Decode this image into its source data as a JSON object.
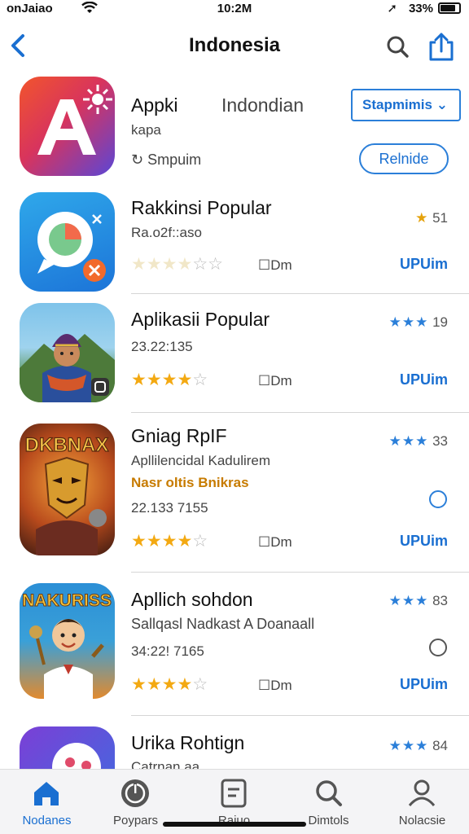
{
  "status": {
    "carrier": "onJaiao",
    "time": "10:2M",
    "battery": "33%"
  },
  "nav": {
    "title": "Indonesia"
  },
  "apps": [
    {
      "name": "Appki",
      "name_extra": "Indondian",
      "sub": "kapa",
      "extra": "Smpuim",
      "dropdown": "Stapmimis",
      "button": "Relnide"
    },
    {
      "name": "Rakkinsi Popular",
      "sub": "Ra.o2f::aso",
      "mid": "Dm",
      "rating": "51",
      "get": "UPUim"
    },
    {
      "name": "Aplikasii Popular",
      "sub": "23.22:135",
      "mid": "Dm",
      "rating": "19",
      "get": "UPUim"
    },
    {
      "name": "Gniag RpIF",
      "sub": "Apllilencidal Kadulirem",
      "sub2": "Nasr oltis Bnikras",
      "sub3": "22.133 7155",
      "mid": "Dm",
      "rating": "33",
      "get": "UPUim"
    },
    {
      "name": "Apllich sohdon",
      "sub": "Sallqasl Nadkast A Doanaall",
      "sub3": "34:22! 7165",
      "mid": "Dm",
      "rating": "83",
      "get": "UPUim"
    },
    {
      "name": "Urika Rohtign",
      "sub": "Catrnan aa",
      "rating": "84"
    }
  ],
  "icons": {
    "app1": {
      "label": "DKBNAX"
    },
    "app2": {
      "label": "NAKURISS"
    }
  },
  "tabs": [
    {
      "label": "Nodanes",
      "icon": "home-icon"
    },
    {
      "label": "Poypars",
      "icon": "power-icon"
    },
    {
      "label": "Rajuo",
      "icon": "document-icon"
    },
    {
      "label": "Dimtols",
      "icon": "search-icon"
    },
    {
      "label": "Nolacsie",
      "icon": "person-icon"
    }
  ],
  "colors": {
    "accent": "#1a6fd1",
    "star": "#f3a912"
  }
}
